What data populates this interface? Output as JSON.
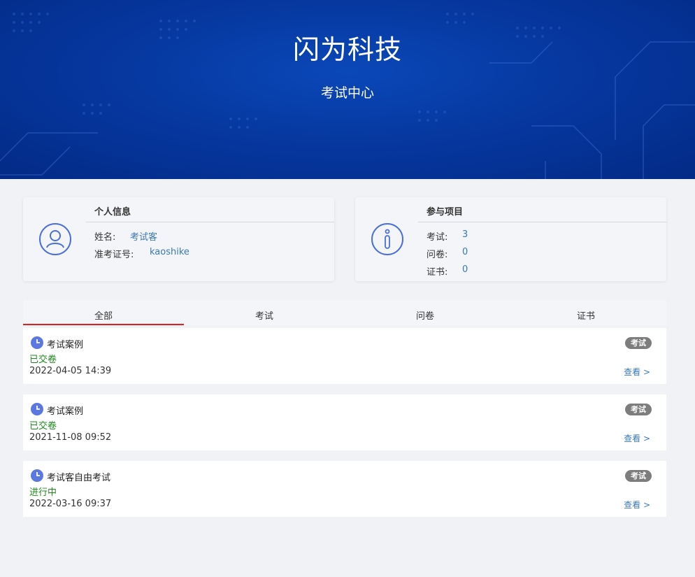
{
  "header": {
    "title": "闪为科技",
    "subtitle": "考试中心"
  },
  "personal": {
    "title": "个人信息",
    "name_label": "姓名:",
    "name_value": "考试客",
    "id_label": "准考证号:",
    "id_value": "kaoshike"
  },
  "projects": {
    "title": "参与项目",
    "exam_label": "考试:",
    "exam_value": "3",
    "survey_label": "问卷:",
    "survey_value": "0",
    "cert_label": "证书:",
    "cert_value": "0"
  },
  "tabs": [
    {
      "label": "全部"
    },
    {
      "label": "考试"
    },
    {
      "label": "问卷"
    },
    {
      "label": "证书"
    }
  ],
  "records": [
    {
      "title": "考试案例",
      "status": "已交卷",
      "date": "2022-04-05 14:39",
      "badge": "考试",
      "action": "查看 >"
    },
    {
      "title": "考试案例",
      "status": "已交卷",
      "date": "2021-11-08 09:52",
      "badge": "考试",
      "action": "查看 >"
    },
    {
      "title": "考试客自由考试",
      "status": "进行中",
      "date": "2022-03-16 09:37",
      "badge": "考试",
      "action": "查看 >"
    }
  ],
  "colors": {
    "banner": "#0638a0",
    "link": "#3a78b8",
    "status_green": "#1c8a1c",
    "tab_active_underline": "#e02020",
    "icon_blue": "#4a6fd8"
  },
  "icons": {
    "personal": "user-icon",
    "projects": "info-icon",
    "record": "clock-icon"
  }
}
